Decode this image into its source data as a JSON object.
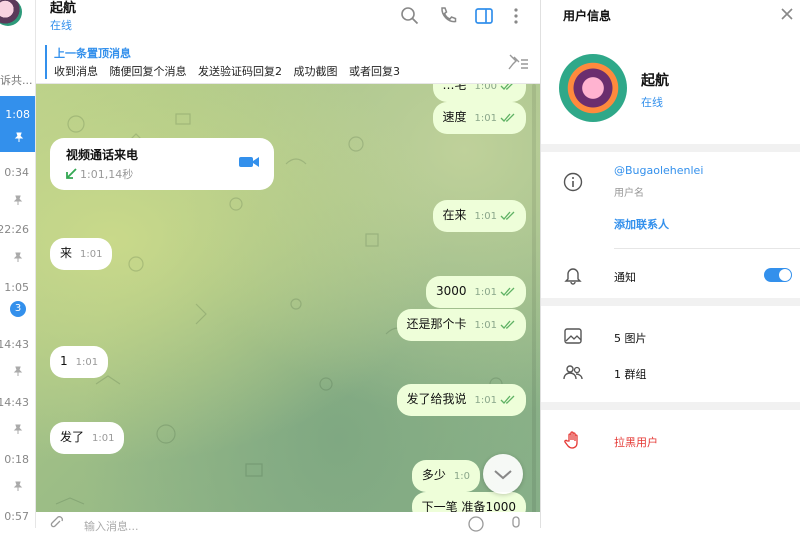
{
  "sidebar": {
    "truncated_name": "诉共...",
    "times": [
      "1:08",
      "0:34",
      "22:26",
      "1:05",
      "14:43",
      "14:43",
      "0:18",
      "0:57"
    ],
    "unread_badge": "3"
  },
  "header": {
    "title": "起航",
    "status": "在线",
    "icons": [
      "search-icon",
      "phone-icon",
      "sidebar-toggle-icon",
      "more-icon"
    ]
  },
  "pinned": {
    "title": "上一条置顶消息",
    "text": "收到消息 随便回复个消息 发送验证码回复2 成功截图 或者回复3"
  },
  "messages": [
    {
      "dir": "out",
      "text": "…宅",
      "time": "1:00"
    },
    {
      "dir": "out",
      "text": "速度",
      "time": "1:01"
    },
    {
      "dir": "out",
      "text": "在来",
      "time": "1:01"
    },
    {
      "dir": "in",
      "text": "来",
      "time": "1:01"
    },
    {
      "dir": "out",
      "text": "3000",
      "time": "1:01"
    },
    {
      "dir": "out",
      "text": "还是那个卡",
      "time": "1:01"
    },
    {
      "dir": "in",
      "text": "1",
      "time": "1:01"
    },
    {
      "dir": "out",
      "text": "发了给我说",
      "time": "1:01"
    },
    {
      "dir": "in",
      "text": "发了",
      "time": "1:01"
    },
    {
      "dir": "out",
      "text": "多少",
      "time": "1:0"
    },
    {
      "dir": "out",
      "text": "下一笔 准备1000",
      "time": ""
    }
  ],
  "call": {
    "title": "视频通话来电",
    "detail": "1:01,14秒"
  },
  "input": {
    "placeholder": "输入消息..."
  },
  "profile": {
    "panel_title": "用户信息",
    "name": "起航",
    "status": "在线",
    "username": "@Bugaolehenlei",
    "username_label": "用户名",
    "add_contact": "添加联系人",
    "notifications": "通知",
    "notifications_on": true,
    "photos": "5 图片",
    "groups": "1 群组",
    "block": "拉黑用户"
  },
  "colors": {
    "accent": "#3390ec",
    "outgoing_bubble": "#eefed9",
    "danger": "#e53935"
  }
}
